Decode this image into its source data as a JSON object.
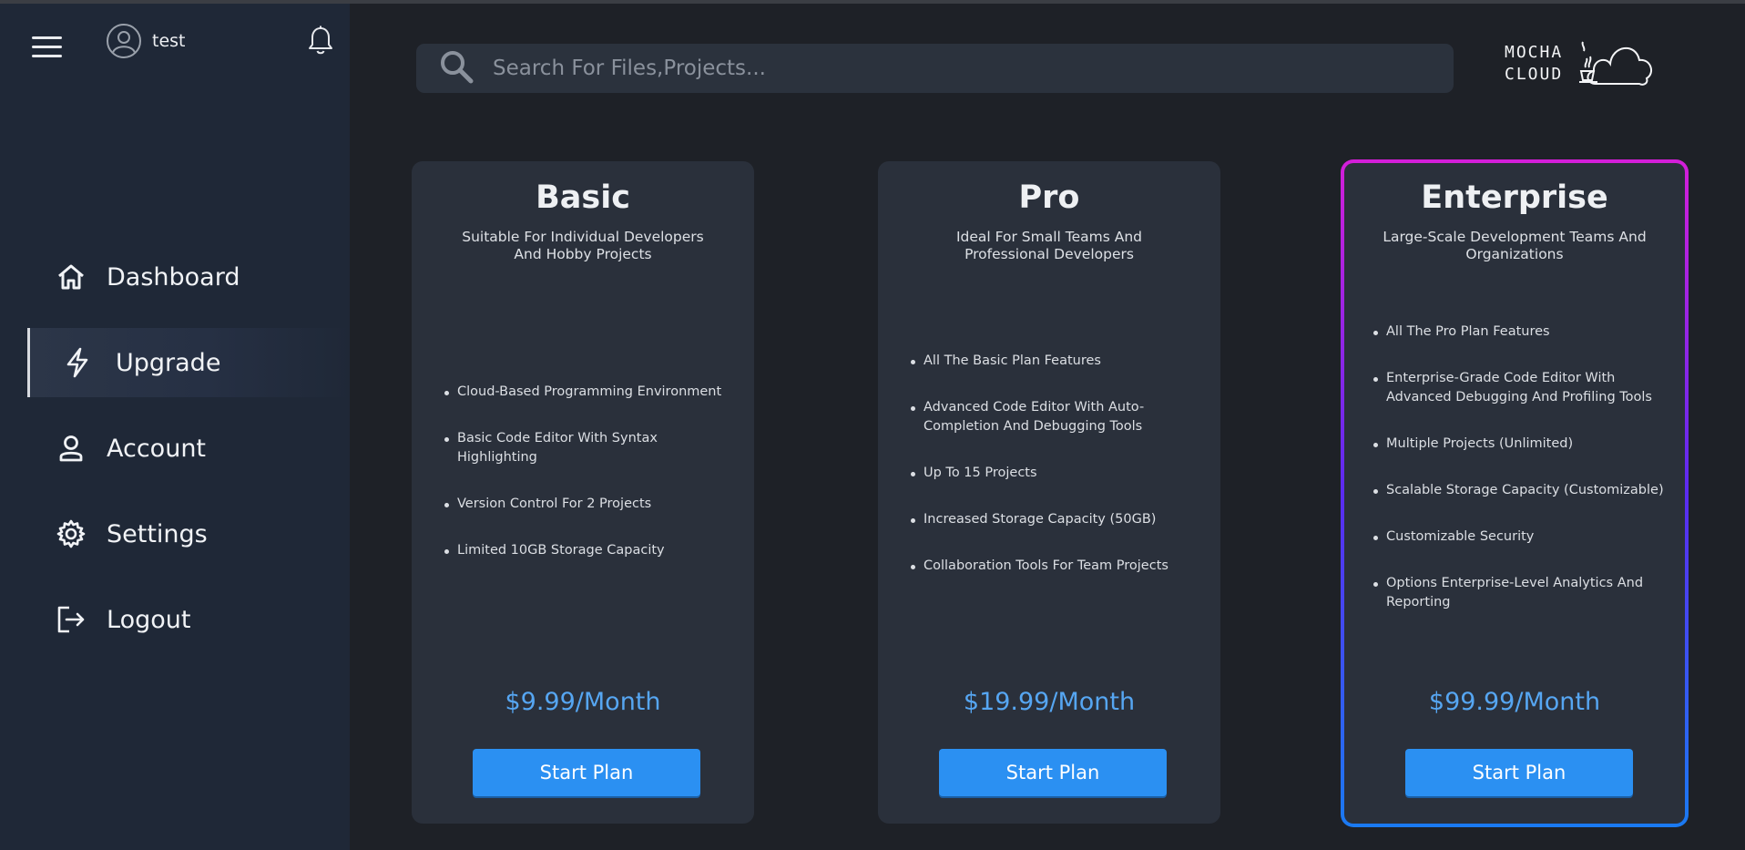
{
  "user": {
    "name": "test"
  },
  "sidebar": {
    "items": [
      {
        "label": "Dashboard",
        "icon": "home-icon"
      },
      {
        "label": "Upgrade",
        "icon": "lightning-icon",
        "active": true
      },
      {
        "label": "Account",
        "icon": "user-icon"
      },
      {
        "label": "Settings",
        "icon": "gear-icon"
      },
      {
        "label": "Logout",
        "icon": "logout-icon"
      }
    ]
  },
  "search": {
    "placeholder": "Search For Files,Projects..."
  },
  "logo": {
    "line1": "MOCHA",
    "line2": "CLOUD"
  },
  "plans": [
    {
      "title": "Basic",
      "subtitle": "Suitable For Individual Developers And Hobby Projects",
      "features": [
        "Cloud-Based Programming Environment",
        "Basic Code Editor With Syntax Highlighting",
        "Version Control For 2 Projects",
        "Limited 10GB Storage Capacity"
      ],
      "price": "$9.99/Month",
      "button": "Start Plan"
    },
    {
      "title": "Pro",
      "subtitle": "Ideal For Small Teams And Professional Developers",
      "features": [
        "All The Basic Plan Features",
        "Advanced Code Editor With Auto-Completion And Debugging Tools",
        "Up To 15 Projects",
        "Increased Storage Capacity (50GB)",
        "Collaboration Tools For Team Projects"
      ],
      "price": "$19.99/Month",
      "button": "Start Plan"
    },
    {
      "title": "Enterprise",
      "subtitle": "Large-Scale Development Teams And Organizations",
      "features": [
        "All The Pro Plan Features",
        "Enterprise-Grade Code Editor With Advanced Debugging And Profiling Tools",
        "Multiple Projects (Unlimited)",
        "Scalable Storage Capacity (Customizable)",
        "Customizable Security",
        "Options Enterprise-Level Analytics And Reporting"
      ],
      "price": "$99.99/Month",
      "button": "Start Plan",
      "highlighted": true
    }
  ],
  "colors": {
    "background": "#1e2127",
    "sidebar": "#1f2837",
    "card": "#2a303b",
    "accent": "#2b90f2",
    "price": "#56a6f2",
    "highlight_gradient": [
      "#d41ed9",
      "#1a7af2"
    ]
  }
}
